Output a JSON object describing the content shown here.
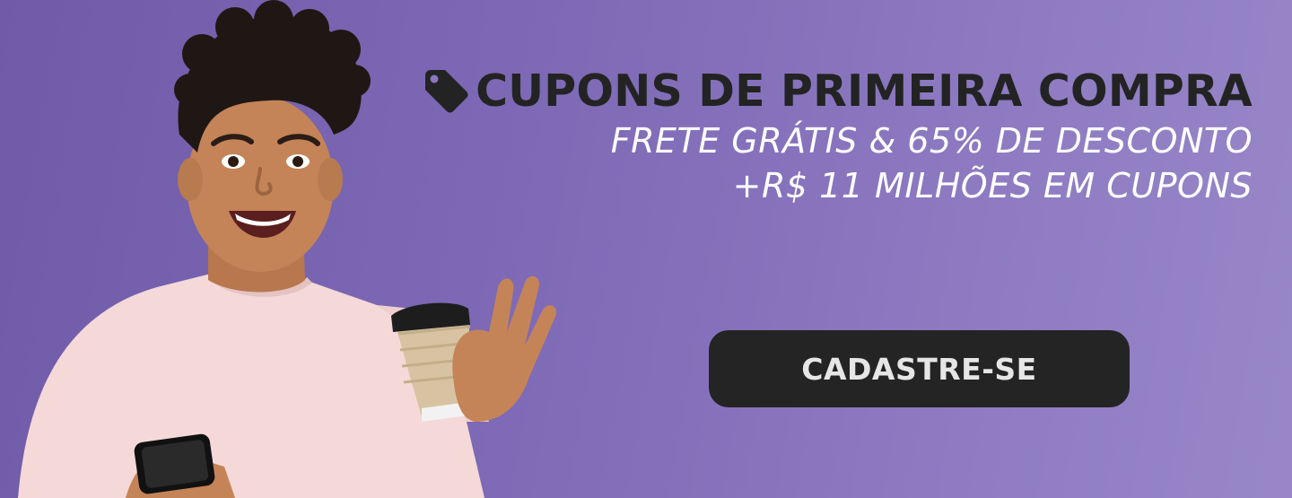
{
  "banner": {
    "headline": "CUPONS DE PRIMEIRA COMPRA",
    "subline_1": "FRETE GRÁTIS & 65% DE DESCONTO",
    "subline_2": "+R$ 11 MILHÕES EM CUPONS",
    "cta_label": "CADASTRE-SE",
    "icons": {
      "headline_icon": "price-tag-icon"
    },
    "colors": {
      "background": "#7d69b5",
      "headline_text": "#232323",
      "subline_text": "#ffffff",
      "button_background": "#242424",
      "button_text": "#e6e6e6"
    }
  }
}
